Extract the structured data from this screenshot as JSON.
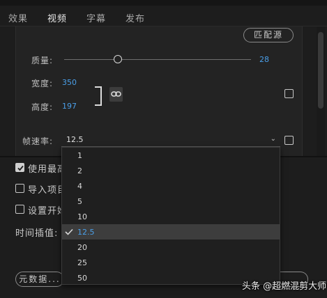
{
  "tabs": [
    {
      "label": "效果"
    },
    {
      "label": "视频"
    },
    {
      "label": "字幕"
    },
    {
      "label": "发布"
    }
  ],
  "active_tab": "视频",
  "video": {
    "match_source_label": "匹配源",
    "quality_label": "质量:",
    "quality_value": "28",
    "width_label": "宽度:",
    "width_value": "350",
    "height_label": "高度:",
    "height_value": "197",
    "frame_rate_label": "帧速率:",
    "frame_rate_value": "12.5"
  },
  "lower": {
    "use_max_label": "使用最高",
    "use_max_checked": true,
    "import_label": "导入项目",
    "import_checked": false,
    "set_start_label": "设置开始",
    "set_start_checked": false,
    "time_interp_label": "时间插值:",
    "metadata_button": "元数据..."
  },
  "frame_rate_options": [
    "1",
    "2",
    "4",
    "5",
    "10",
    "12.5",
    "20",
    "25",
    "50"
  ],
  "frame_rate_selected": "12.5",
  "watermark": "头条 @超燃混剪大师",
  "colors": {
    "accent": "#4a9fe8",
    "background": "#1d1d1d",
    "panel": "#232323"
  }
}
